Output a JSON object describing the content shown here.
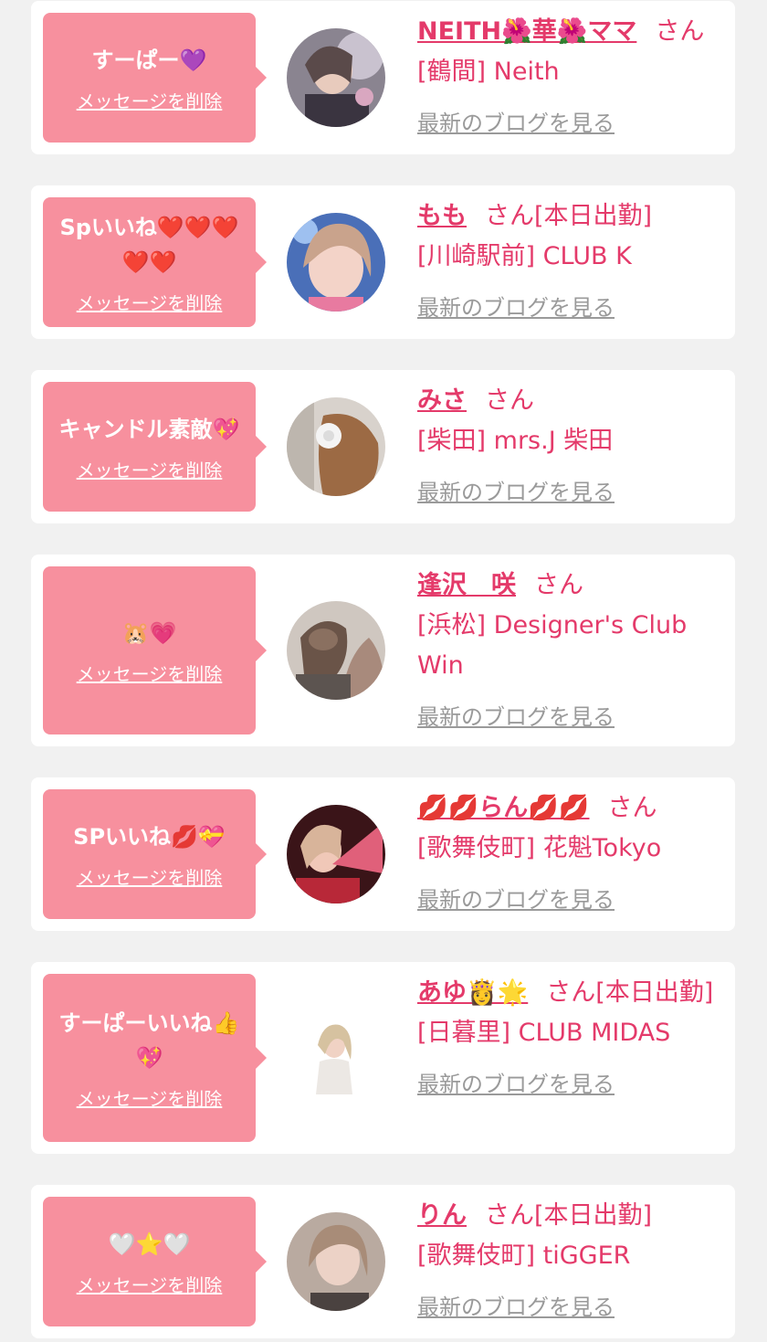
{
  "delete_label": "メッセージを削除",
  "blog_label": "最新のブログを見る",
  "honorific": "さん",
  "colors": {
    "bubble": "#f7909e",
    "accent": "#e43a6a",
    "link_gray": "#9a9a9a",
    "background": "#f1f1f1"
  },
  "items": [
    {
      "message": "すーぱー💜",
      "name": "NEITH🌺華🌺ママ",
      "status": "",
      "shop": "[鶴間] Neith",
      "avatar": "avatar-1"
    },
    {
      "message": "Spいいね❤️❤️❤️❤️❤️",
      "name": "もも",
      "status": "[本日出勤]",
      "shop": "[川崎駅前] CLUB K",
      "avatar": "avatar-2"
    },
    {
      "message": "キャンドル素敵💖",
      "name": "みさ",
      "status": "",
      "shop": "[柴田] mrs.J 柴田",
      "avatar": "avatar-3"
    },
    {
      "message": "🐹💗",
      "name": "逢沢　咲",
      "status": "",
      "shop": "[浜松] Designer's Club Win",
      "avatar": "avatar-4"
    },
    {
      "message": "SPいいね💋💝",
      "name": "💋💋らん💋💋",
      "status": "",
      "shop": "[歌舞伎町] 花魁Tokyo",
      "avatar": "avatar-5"
    },
    {
      "message": "すーぱーいいね👍💖",
      "name": "あゆ👸🌟",
      "status": "[本日出勤]",
      "shop": "[日暮里] CLUB MIDAS",
      "avatar": "avatar-6"
    },
    {
      "message": "🤍⭐️🤍",
      "name": "りん",
      "status": "[本日出勤]",
      "shop": "[歌舞伎町] tiGGER",
      "avatar": "avatar-7"
    }
  ]
}
